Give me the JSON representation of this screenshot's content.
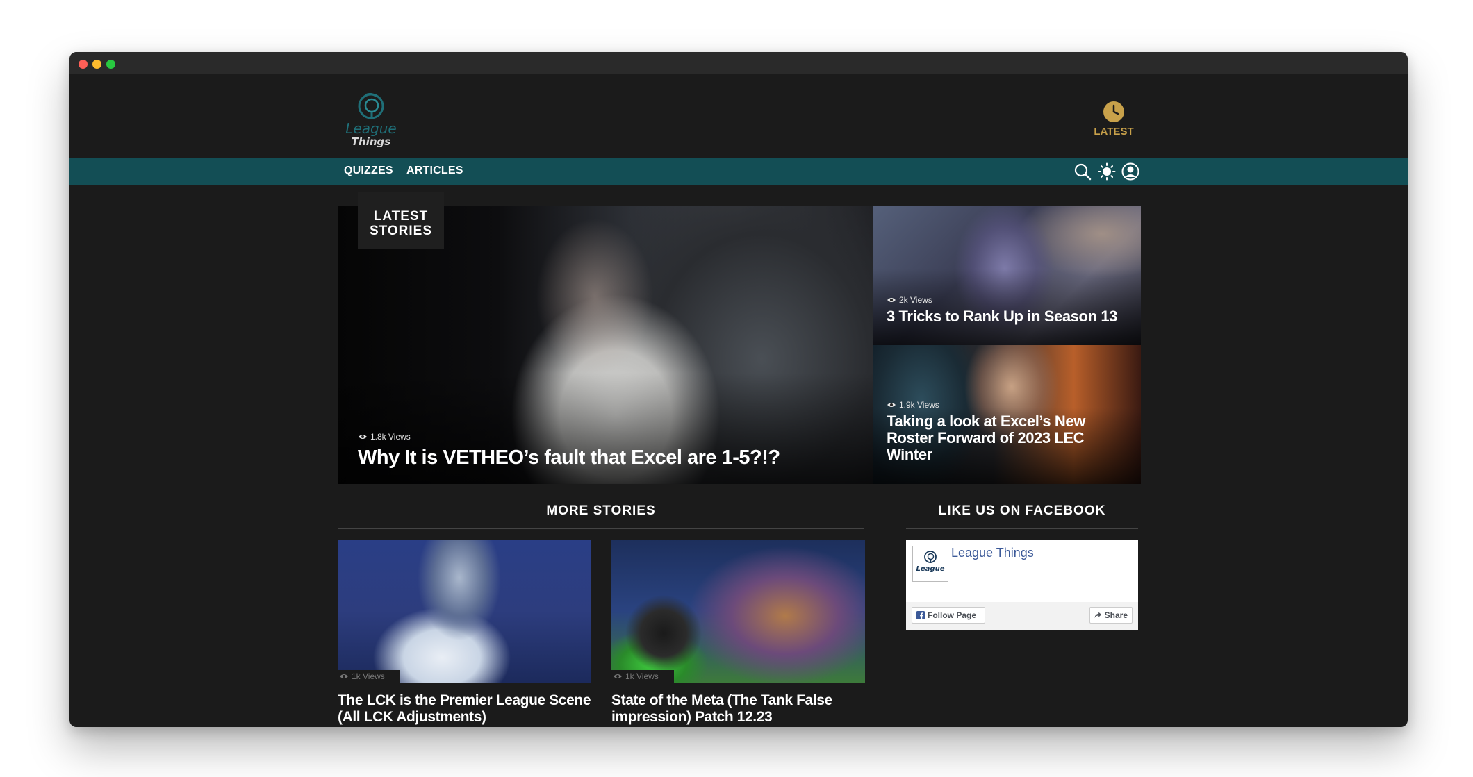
{
  "header": {
    "logo_line1": "League",
    "logo_line2": "Things",
    "latest_label": "LATEST"
  },
  "nav": {
    "items": [
      {
        "label": "QUIZZES"
      },
      {
        "label": "ARTICLES"
      }
    ],
    "icons": [
      "search-icon",
      "theme-sun-icon",
      "user-icon"
    ]
  },
  "hero": {
    "badge_line1": "LATEST",
    "badge_line2": "STORIES",
    "main": {
      "views": "1.8k Views",
      "title": "Why It is VETHEO’s fault that Excel are 1-5?!?"
    },
    "side": [
      {
        "views": "2k Views",
        "title": "3 Tricks to Rank Up in Season 13"
      },
      {
        "views": "1.9k Views",
        "title": "Taking a look at Excel’s New Roster Forward of 2023 LEC Winter"
      }
    ]
  },
  "more_stories": {
    "heading": "MORE STORIES",
    "cards": [
      {
        "views": "1k Views",
        "title": "The LCK is the Premier League Scene (All LCK Adjustments)"
      },
      {
        "views": "1k Views",
        "title": "State of the Meta (The Tank False impression) Patch 12.23"
      }
    ]
  },
  "facebook": {
    "heading": "LIKE US ON FACEBOOK",
    "page_name": "League Things",
    "avatar_word": "League",
    "follow_label": "Follow Page",
    "share_label": "Share"
  },
  "colors": {
    "background": "#1b1b1b",
    "nav": "#134e55",
    "accent": "#c8a14a",
    "facebook_link": "#3b5998"
  }
}
